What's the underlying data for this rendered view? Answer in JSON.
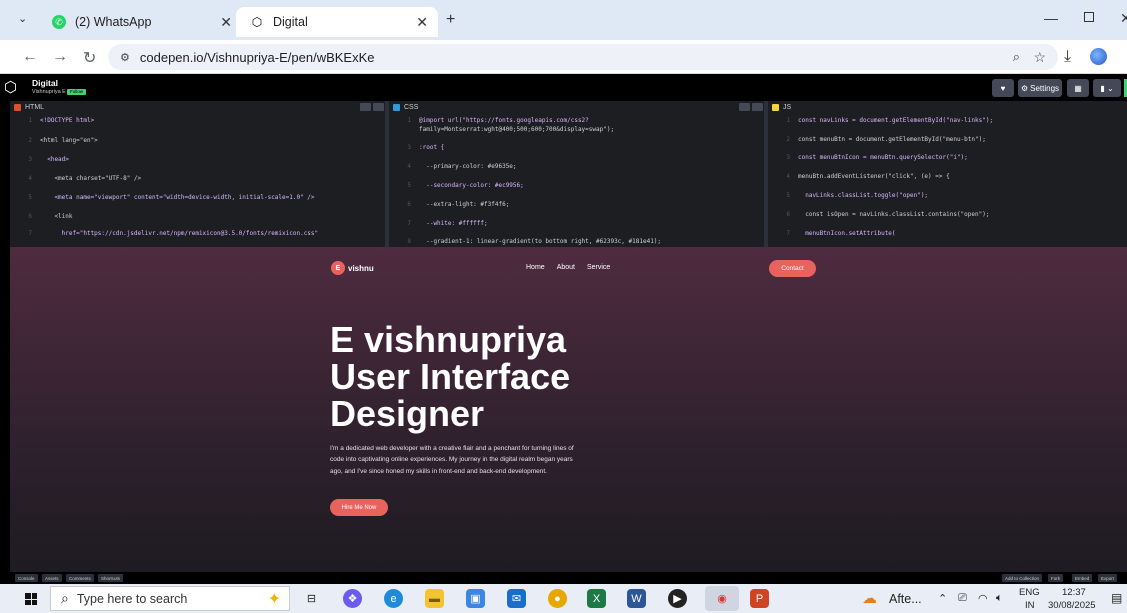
{
  "browser": {
    "tabs": [
      {
        "label": "(2) WhatsApp",
        "icon": "whatsapp-icon"
      },
      {
        "label": "Digital",
        "icon": "codepen-icon"
      }
    ],
    "url": "codepen.io/Vishnupriya-E/pen/wBKExKe"
  },
  "codepen": {
    "title": "Digital",
    "author": "Vishnupriya E",
    "badge": "Follow",
    "settings_label": "Settings",
    "panes": [
      {
        "name": "HTML",
        "color": "#e04f2d"
      },
      {
        "name": "CSS",
        "color": "#2e9bd6"
      },
      {
        "name": "JS",
        "color": "#f5d33a"
      }
    ],
    "html_lines": [
      {
        "n": "1",
        "t": "<!DOCTYPE html>"
      },
      {
        "n": "2",
        "t": "<html lang=\"en\">"
      },
      {
        "n": "3",
        "t": "  <head>"
      },
      {
        "n": "4",
        "t": "    <meta charset=\"UTF-8\" />"
      },
      {
        "n": "5",
        "t": "    <meta name=\"viewport\" content=\"width=device-width, initial-scale=1.0\" />"
      },
      {
        "n": "6",
        "t": "    <link"
      },
      {
        "n": "7",
        "t": "      href=\"https://cdn.jsdelivr.net/npm/remixicon@3.5.0/fonts/remixicon.css\""
      }
    ],
    "css_lines": [
      {
        "n": "1",
        "t": "@import url(\"https://fonts.googleapis.com/css2?"
      },
      {
        "n": "",
        "t": "family=Montserrat:wght@400;500;600;700&display=swap\");"
      },
      {
        "n": "3",
        "t": ":root {"
      },
      {
        "n": "4",
        "t": "  --primary-color: #e9635e;"
      },
      {
        "n": "5",
        "t": "  --secondary-color: #ec9956;"
      },
      {
        "n": "6",
        "t": "  --extra-light: #f3f4f6;"
      },
      {
        "n": "7",
        "t": "  --white: #ffffff;"
      },
      {
        "n": "8",
        "t": "  --gradient-1: linear-gradient(to bottom right, #62393c, #181e41);"
      }
    ],
    "js_lines": [
      {
        "n": "1",
        "t": "const navLinks = document.getElementById(\"nav-links\");"
      },
      {
        "n": "2",
        "t": "const menuBtn = document.getElementById(\"menu-btn\");"
      },
      {
        "n": "3",
        "t": "const menuBtnIcon = menuBtn.querySelector(\"i\");"
      },
      {
        "n": "4",
        "t": "menuBtn.addEventListener(\"click\", (e) => {"
      },
      {
        "n": "5",
        "t": "  navLinks.classList.toggle(\"open\");"
      },
      {
        "n": "6",
        "t": "  const isOpen = navLinks.classList.contains(\"open\");"
      },
      {
        "n": "7",
        "t": "  menuBtnIcon.setAttribute("
      }
    ],
    "bottom_left": [
      "Console",
      "Assets",
      "Comments",
      "Shortcuts"
    ],
    "bottom_right": [
      "Add to Collection",
      "Fork",
      "Embed",
      "Export",
      "Share"
    ]
  },
  "site": {
    "logo_letter": "E",
    "logo_text": "vishnu",
    "nav": [
      "Home",
      "About",
      "Service"
    ],
    "contact": "Contact",
    "heading_line1": "E vishnupriya",
    "heading_line2": "User Interface",
    "heading_line3": "Designer",
    "para": "I'm a dedicated web developer with a creative flair and a penchant for turning lines of code into captivating online experiences. My journey in the digital realm began years ago, and I've since honed my skills in front-end and back-end development.",
    "cta": "Hire Me Now",
    "accent": "#e9635e"
  },
  "taskbar": {
    "search_placeholder": "Type here to search",
    "weather": "Afte...",
    "lang1": "ENG",
    "lang2": "IN",
    "time": "12:37",
    "date": "30/08/2025"
  }
}
